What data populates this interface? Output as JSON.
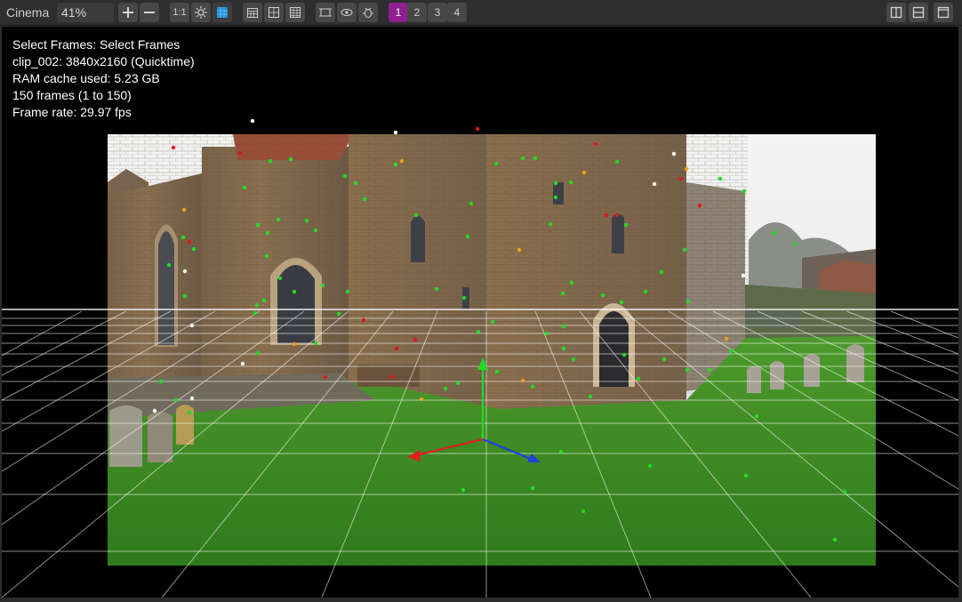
{
  "toolbar": {
    "view_label": "Cinema",
    "zoom_value": "41%",
    "one_to_one_label": "1:1",
    "view_numbers": [
      {
        "label": "1",
        "selected": true
      },
      {
        "label": "2",
        "selected": false
      },
      {
        "label": "3",
        "selected": false
      },
      {
        "label": "4",
        "selected": false
      }
    ],
    "accent_color": "#8e1f8e"
  },
  "viewport": {
    "info_lines": [
      "Select Frames: Select Frames",
      "clip_002: 3840x2160 (Quicktime)",
      "RAM cache used: 5.23 GB",
      "150 frames (1 to 150)",
      "Frame rate: 29.97 fps"
    ],
    "track_point_colors": {
      "solved": "#22dd22",
      "rejected": "#e01818",
      "pending": "#f0a020",
      "selected": "#ffffff"
    },
    "axis_colors": {
      "x": "#e02020",
      "y": "#22dd22",
      "z": "#2040e0"
    }
  }
}
